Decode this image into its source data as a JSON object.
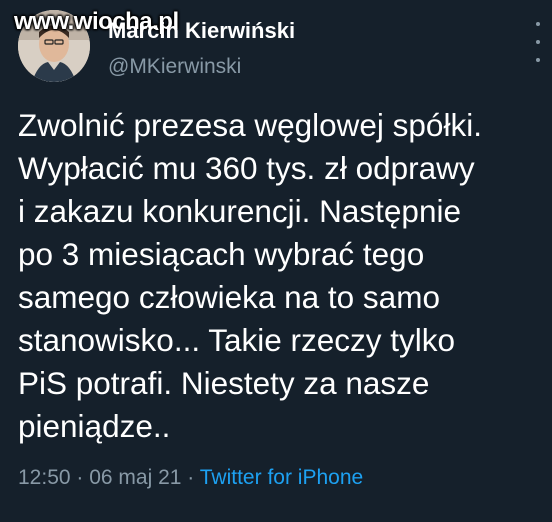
{
  "watermark": "www.wiocha.pl",
  "author": {
    "name": "Marcin Kierwiński",
    "handle": "@MKierwinski"
  },
  "tweet": {
    "text": "Zwolnić prezesa węglowej spółki.\nWypłacić mu 360 tys. zł odprawy\ni zakazu konkurencji. Następnie\npo 3 miesiącach wybrać tego\nsamego człowieka na to samo\nstanowisko... Takie rzeczy tylko\nPiS potrafi. Niestety za nasze\npieniądze..",
    "time": "12:50",
    "separator_1": " · ",
    "date": "06 maj 21",
    "separator_2": " · ",
    "source": "Twitter for iPhone"
  },
  "icons": {
    "more": "more-vertical-icon",
    "avatar": "avatar"
  },
  "colors": {
    "background": "#15202b",
    "text": "#ffffff",
    "muted": "#8899a6",
    "link": "#1da1f2"
  }
}
